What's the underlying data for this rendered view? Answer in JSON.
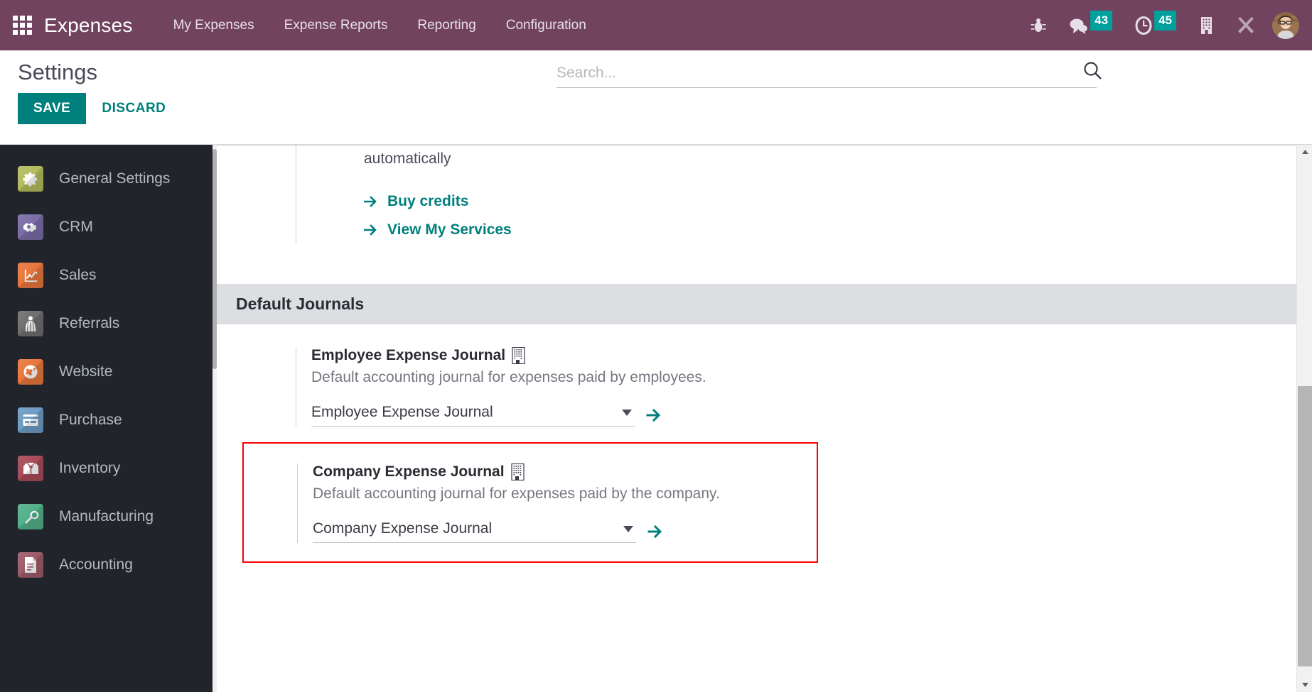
{
  "navbar": {
    "apps_icon": "apps-grid-icon",
    "brand": "Expenses",
    "menu": [
      {
        "label": "My Expenses"
      },
      {
        "label": "Expense Reports"
      },
      {
        "label": "Reporting"
      },
      {
        "label": "Configuration"
      }
    ],
    "systray": [
      {
        "name": "bug-icon",
        "badge": null
      },
      {
        "name": "messages-icon",
        "badge": "43"
      },
      {
        "name": "activities-clock-icon",
        "badge": "45"
      },
      {
        "name": "company-building-icon",
        "badge": null
      },
      {
        "name": "developer-tools-icon",
        "badge": null
      }
    ],
    "badge_color": "#00a09d",
    "background_color": "#71435f",
    "avatar_alt": "user-avatar"
  },
  "control_panel": {
    "title": "Settings",
    "save_label": "SAVE",
    "discard_label": "DISCARD",
    "search_placeholder": "Search...",
    "search_value": "",
    "search_icon": "search-icon"
  },
  "sidebar": {
    "items": [
      {
        "label": "General Settings",
        "icon": "gear-icon",
        "color": "#b2bc5c"
      },
      {
        "label": "CRM",
        "icon": "handshake-icon",
        "color": "#7a6ca8"
      },
      {
        "label": "Sales",
        "icon": "line-chart-icon",
        "color": "#e8763c"
      },
      {
        "label": "Referrals",
        "icon": "person-cape-icon",
        "color": "#6e6e6e"
      },
      {
        "label": "Website",
        "icon": "globe-icon",
        "color": "#e8763c"
      },
      {
        "label": "Purchase",
        "icon": "credit-card-icon",
        "color": "#6c9bc4"
      },
      {
        "label": "Inventory",
        "icon": "open-box-icon",
        "color": "#a84a57"
      },
      {
        "label": "Manufacturing",
        "icon": "wrench-icon",
        "color": "#52b089"
      },
      {
        "label": "Accounting",
        "icon": "document-icon",
        "color": "#9c5b68"
      }
    ]
  },
  "main": {
    "iap_tail_text": "automatically",
    "links": [
      {
        "label": "Buy credits",
        "icon": "arrow-right-icon"
      },
      {
        "label": "View My Services",
        "icon": "arrow-right-icon"
      }
    ],
    "section_title": "Default Journals",
    "journals": [
      {
        "title": "Employee Expense Journal",
        "title_icon": "company-building-icon",
        "help": "Default accounting journal for expenses paid by employees.",
        "value": "Employee Expense Journal",
        "caret_icon": "chevron-down-icon",
        "link_icon": "internal-link-arrow-icon",
        "highlighted": false
      },
      {
        "title": "Company Expense Journal",
        "title_icon": "company-building-icon",
        "help": "Default accounting journal for expenses paid by the company.",
        "value": "Company Expense Journal",
        "caret_icon": "chevron-down-icon",
        "link_icon": "internal-link-arrow-icon",
        "highlighted": true,
        "highlight_color": "#ff0000"
      }
    ]
  },
  "scrollbars": {
    "up_arrow_icon": "scroll-up-arrow-icon",
    "down_arrow_icon": "scroll-down-arrow-icon"
  }
}
